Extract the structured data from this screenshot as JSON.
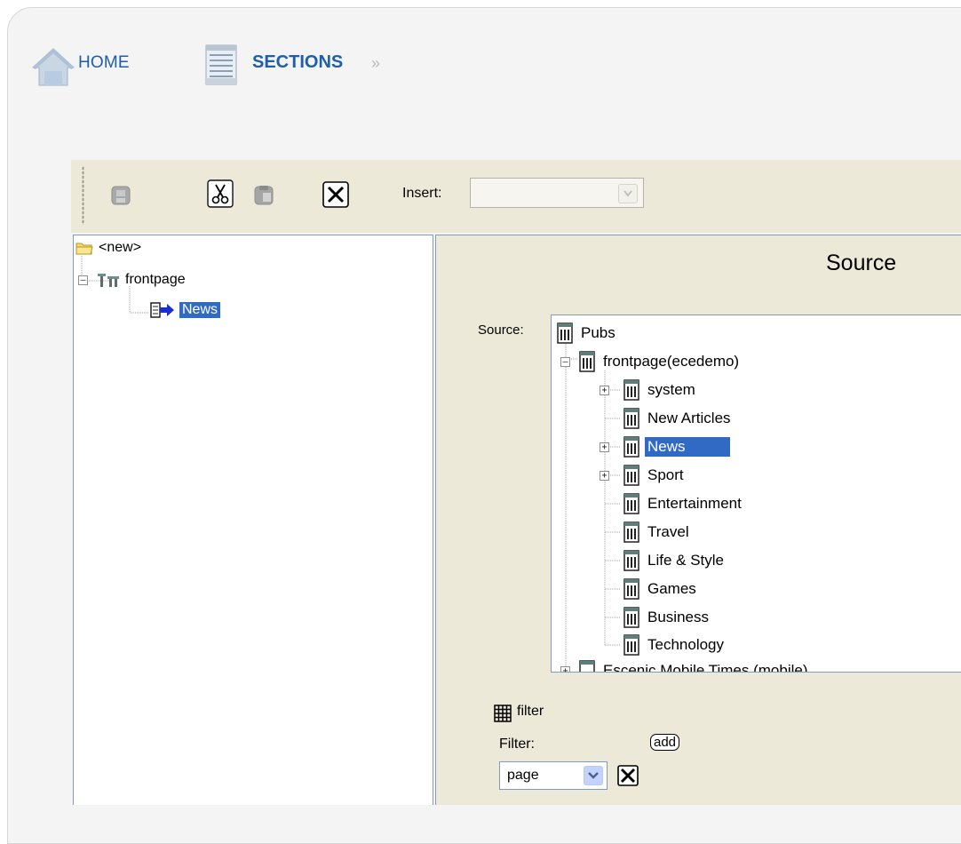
{
  "nav": {
    "home_label": "HOME",
    "sections_label": "SECTIONS",
    "separator": "»"
  },
  "toolbar": {
    "insert_label": "Insert:",
    "insert_value": ""
  },
  "left_tree": {
    "items": [
      {
        "label": "<new>",
        "icon": "folder-icon"
      },
      {
        "label": "frontpage",
        "icon": "publication-icon"
      },
      {
        "label": "News",
        "icon": "section-link-icon",
        "selected": true
      }
    ]
  },
  "panel": {
    "title": "Source",
    "source_label": "Source:"
  },
  "source_tree": {
    "root": "Pubs",
    "publication": "frontpage(ecedemo)",
    "items": [
      {
        "label": "system",
        "expandable": true
      },
      {
        "label": "New Articles",
        "expandable": false
      },
      {
        "label": "News",
        "expandable": true,
        "selected": true
      },
      {
        "label": "Sport",
        "expandable": true
      },
      {
        "label": "Entertainment",
        "expandable": false
      },
      {
        "label": "Travel",
        "expandable": false
      },
      {
        "label": "Life & Style",
        "expandable": false
      },
      {
        "label": "Games",
        "expandable": false
      },
      {
        "label": "Business",
        "expandable": false
      },
      {
        "label": "Technology",
        "expandable": false
      }
    ],
    "partial_next": "Escenic Mobile Times (mobile)"
  },
  "filter": {
    "title": "filter",
    "label": "Filter:",
    "add_label": "add",
    "selected_value": "page"
  },
  "colors": {
    "nav_link": "#1f5ea8",
    "selection": "#316ac5",
    "toolbar_bg": "#ece9d8"
  }
}
